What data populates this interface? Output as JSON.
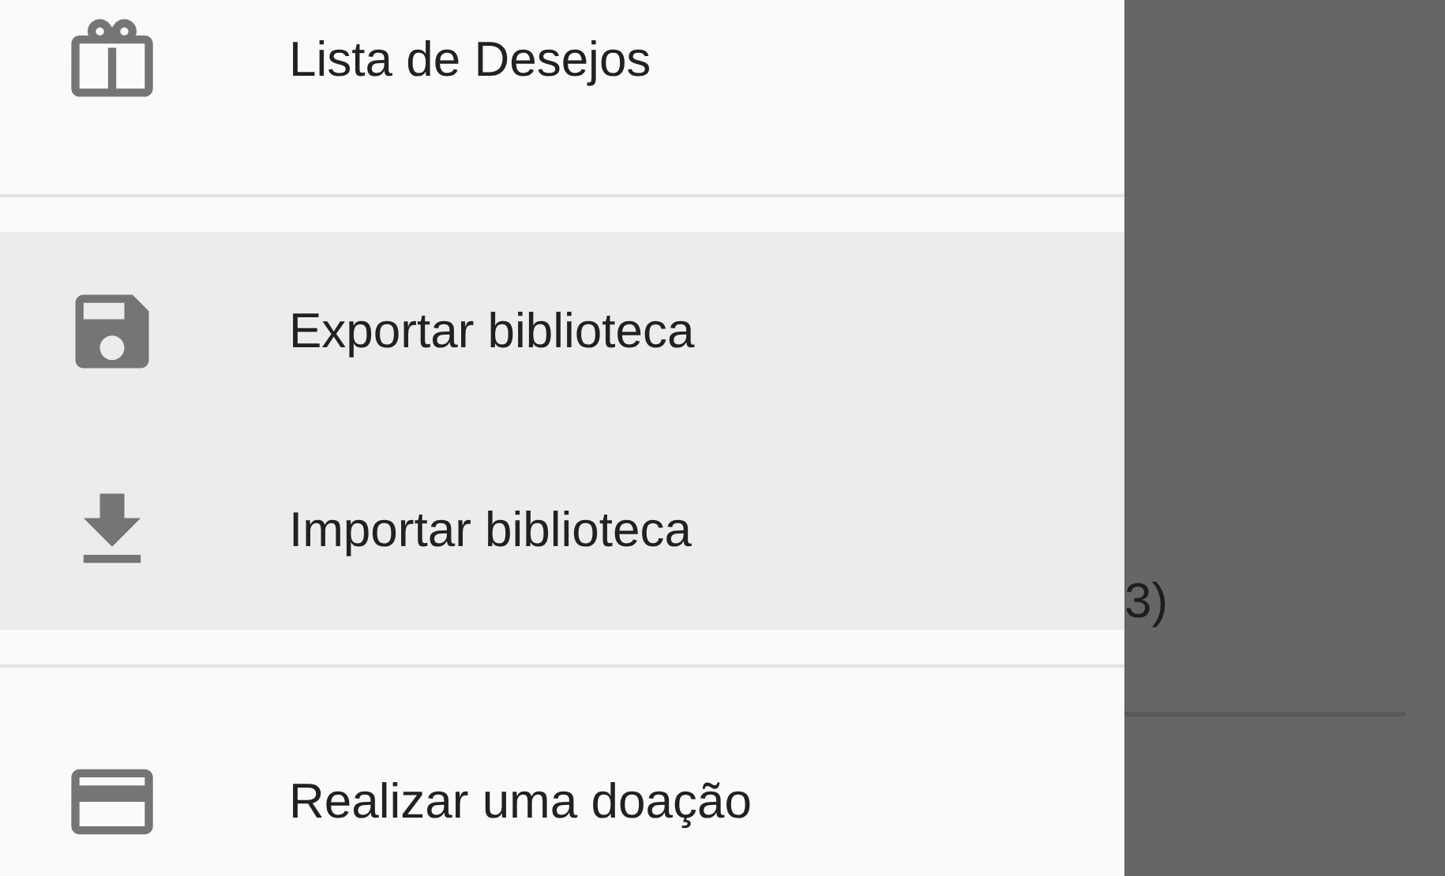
{
  "drawer": {
    "sections": [
      {
        "items": [
          {
            "label": "Lista de Desejos",
            "highlighted": false
          }
        ]
      },
      {
        "items": [
          {
            "label": "Exportar biblioteca",
            "highlighted": true
          },
          {
            "label": "Importar biblioteca",
            "highlighted": true
          }
        ]
      },
      {
        "items": [
          {
            "label": "Realizar uma doação",
            "highlighted": false
          }
        ]
      }
    ]
  },
  "background": {
    "text": "3)"
  }
}
